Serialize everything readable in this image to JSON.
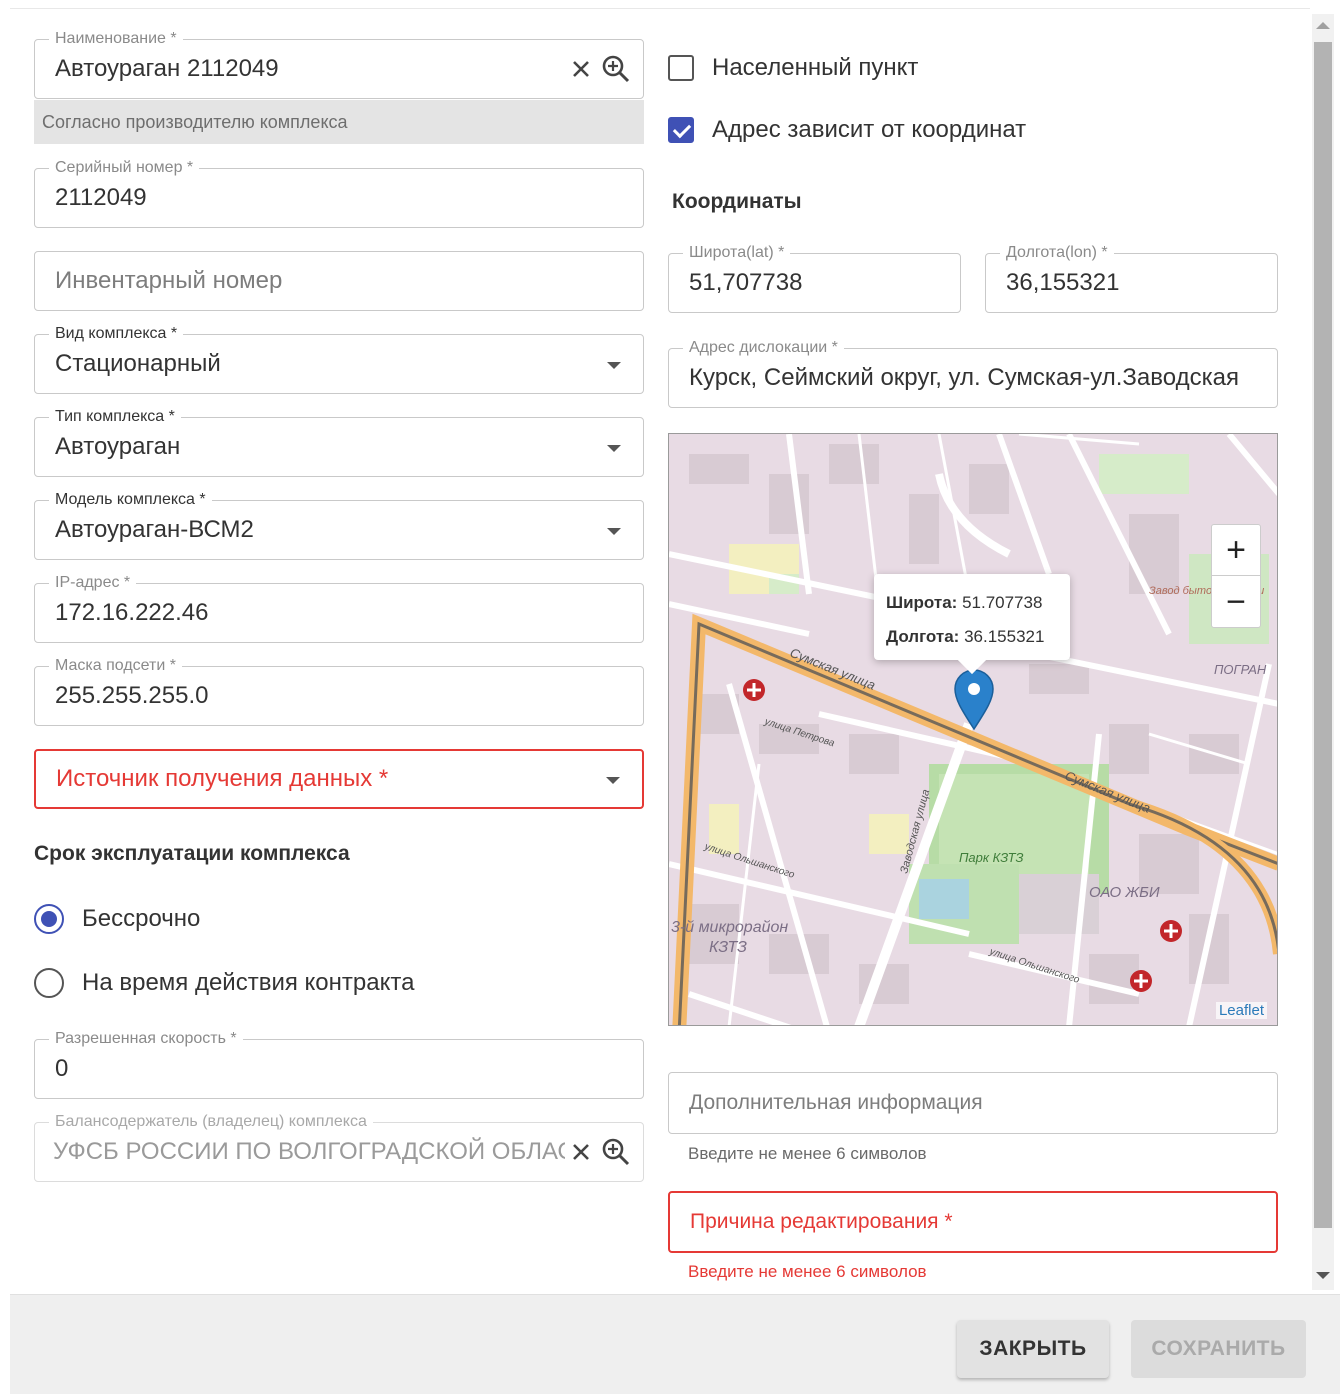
{
  "left": {
    "name": {
      "label": "Наименование *",
      "value": "Автоураган 2112049"
    },
    "name_hint": "Согласно производителю комплекса",
    "serial": {
      "label": "Серийный номер *",
      "value": "2112049"
    },
    "inventory": {
      "placeholder": "Инвентарный номер"
    },
    "complex_kind": {
      "label": "Вид комплекса *",
      "value": "Стационарный"
    },
    "complex_type": {
      "label": "Тип комплекса *",
      "value": "Автоураган"
    },
    "complex_model": {
      "label": "Модель комплекса *",
      "value": "Автоураган-ВСМ2"
    },
    "ip": {
      "label": "IP-адрес *",
      "value": "172.16.222.46"
    },
    "mask": {
      "label": "Маска подсети *",
      "value": "255.255.255.0"
    },
    "data_source": {
      "placeholder": "Источник получения данных *"
    },
    "lifetime_title": "Срок эксплуатации комплекса",
    "lifetime_options": [
      {
        "label": "Бессрочно",
        "selected": true
      },
      {
        "label": "На время действия контракта",
        "selected": false
      }
    ],
    "speed": {
      "label": "Разрешенная скорость *",
      "value": "0"
    },
    "owner": {
      "label": "Балансодержатель (владелец) комплекса",
      "value": "УФСБ РОССИИ ПО ВОЛГОГРАДСКОЙ ОБЛАСТИ"
    }
  },
  "right": {
    "settlement": {
      "label": "Населенный пункт",
      "checked": false
    },
    "addr_by_coords": {
      "label": "Адрес зависит от координат",
      "checked": true
    },
    "coords_title": "Координаты",
    "lat": {
      "label": "Широта(lat) *",
      "value": "51,707738"
    },
    "lon": {
      "label": "Долгота(lon) *",
      "value": "36,155321"
    },
    "address": {
      "label": "Адрес дислокации *",
      "value": "Курск, Сеймский округ, ул. Сумская-ул.Заводская"
    },
    "map": {
      "popup_lat_label": "Широта:",
      "popup_lat_value": "51.707738",
      "popup_lon_label": "Долгота:",
      "popup_lon_value": "36.155321",
      "zoom_in": "+",
      "zoom_out": "−",
      "attribution": "Leaflet",
      "labels": {
        "street1": "Сумская улица",
        "street2": "Сумская улица",
        "street3": "улица Петрова",
        "street4": "Заводская улица",
        "street5": "улица Ольшанского",
        "street6": "улица Ольшанского",
        "park": "Парк КЗТЗ",
        "district": "3-й микрорайон",
        "district2": "КЗТЗ",
        "oao": "ОАО ЖБИ",
        "pogra": "ПОГРАН",
        "zavod": "Завод бытовой химии"
      }
    },
    "extra_info": {
      "placeholder": "Дополнительная информация",
      "helper": "Введите не менее 6 символов"
    },
    "edit_reason": {
      "placeholder": "Причина редактирования *",
      "helper": "Введите не менее 6 символов"
    }
  },
  "footer": {
    "close": "ЗАКРЫТЬ",
    "save": "СОХРАНИТЬ"
  },
  "colors": {
    "accent": "#3f51b5",
    "error": "#e53935",
    "marker": "#2a81cb"
  }
}
